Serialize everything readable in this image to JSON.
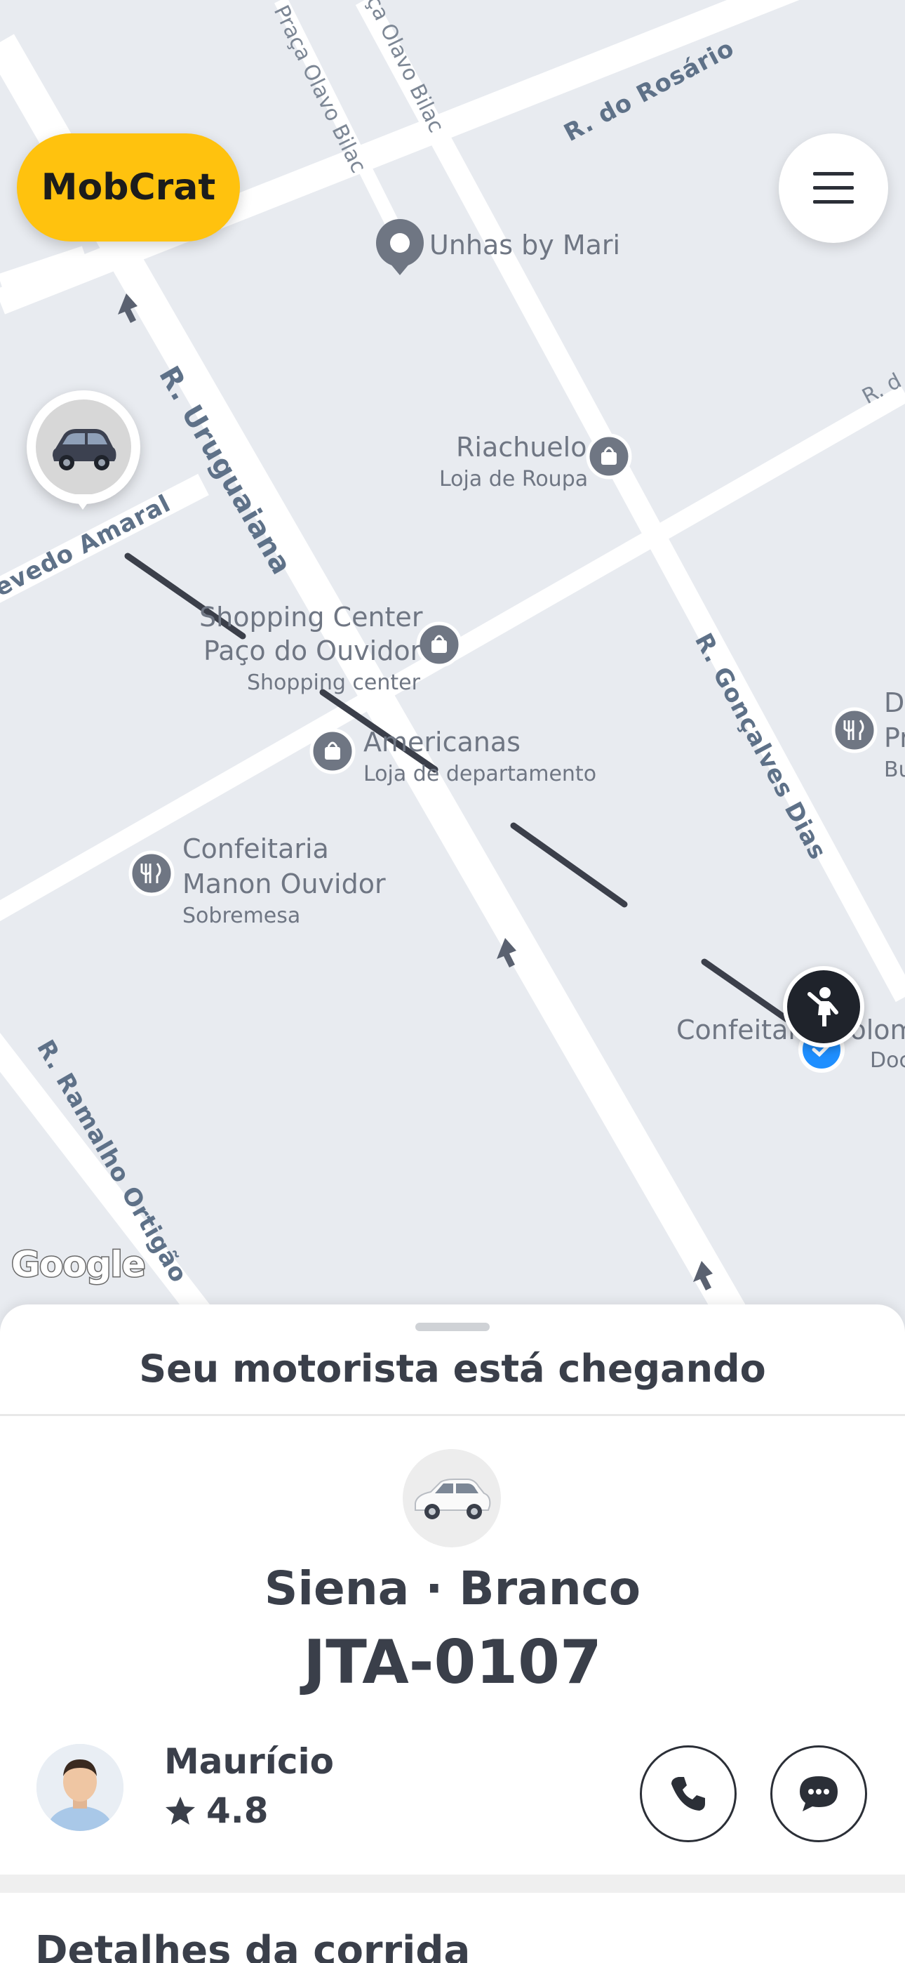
{
  "app": {
    "brand_label": "MobCrat"
  },
  "map": {
    "streets": {
      "praca_olavo_bilac_1": "Praça Olavo Bilac",
      "praca_olavo_bilac_2": "ça Olavo Bilac",
      "rosario": "R. do Rosário",
      "uruguaiana": "R. Uruguaiana",
      "azevedo_amaral": "evedo Amaral",
      "goncalves_dias": "R. Gonçalves Dias",
      "ramalho_ortigao": "R. Ramalho Ortigão",
      "top_right": "R. d"
    },
    "pois": [
      {
        "name": "Unhas by Mari",
        "sub": ""
      },
      {
        "name": "Riachuelo",
        "sub": "Loja de Roupa"
      },
      {
        "name": "Shopping Center",
        "name2": "Paço do Ouvidor",
        "sub": "Shopping center"
      },
      {
        "name": "Americanas",
        "sub": "Loja de departamento"
      },
      {
        "name": "Confeitaria",
        "name2": "Manon Ouvidor",
        "sub": "Sobremesa"
      },
      {
        "name": "Confeitaria Colomb",
        "sub": "Doc"
      },
      {
        "name": "D",
        "name2": "Pr",
        "sub": "Bu"
      }
    ],
    "attribution": "Google"
  },
  "icons": {
    "menu": "hamburger-menu-icon",
    "car": "car-icon",
    "passenger": "passenger-waving-icon",
    "destination": "check-icon",
    "phone": "phone-icon",
    "chat": "chat-bubble-icon",
    "star": "star-icon"
  },
  "sheet": {
    "status_title": "Seu motorista está chegando",
    "vehicle": {
      "model_color": "Siena · Branco",
      "plate": "JTA-0107"
    },
    "driver": {
      "name": "Maurício",
      "rating": "4.8"
    },
    "details_title": "Detalhes da corrida"
  },
  "colors": {
    "brand": "#ffc20e",
    "text_primary": "#3a3f4a",
    "route": "#3b3f4a",
    "destination": "#1f8fff",
    "map_bg": "#e8ebf0"
  }
}
